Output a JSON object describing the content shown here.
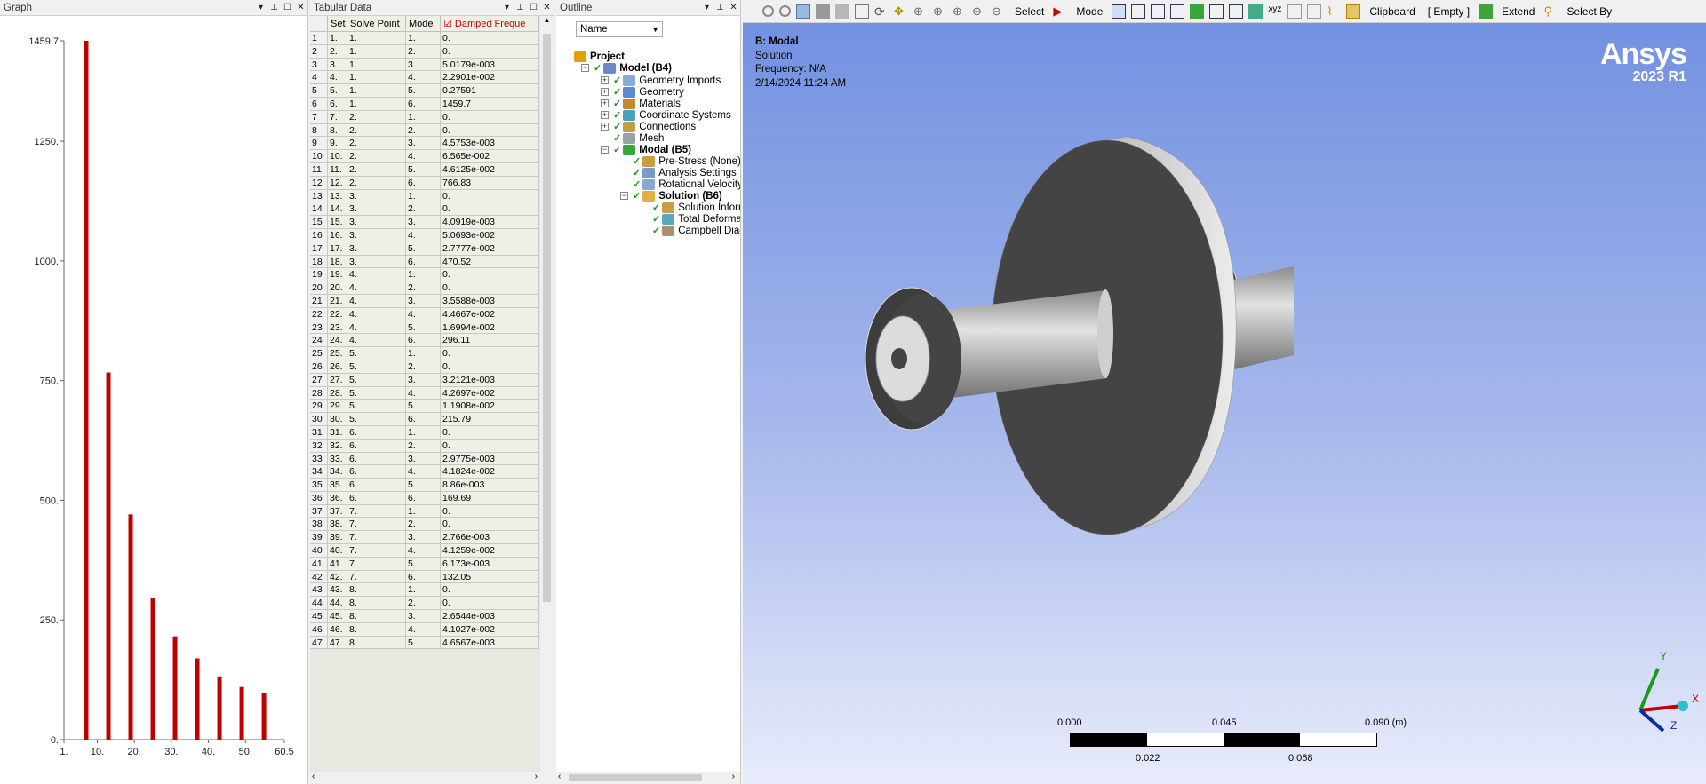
{
  "graph": {
    "title": "Graph",
    "chart_data": {
      "type": "bar",
      "x": [
        7,
        13,
        19,
        25,
        31,
        37,
        43,
        49,
        55
      ],
      "values": [
        1459.7,
        766.83,
        470.52,
        296.11,
        215.79,
        169.69,
        132.05,
        110,
        98
      ],
      "xticks": [
        "1.",
        "10.",
        "20.",
        "30.",
        "40.",
        "50.",
        "60.5"
      ],
      "yticks": [
        "0.",
        "250.",
        "500.",
        "750.",
        "1000.",
        "1250.",
        "1459.7"
      ],
      "xlim": [
        1,
        60.5
      ],
      "ylim": [
        0,
        1459.7
      ],
      "bar_color": "#c00000"
    }
  },
  "tabular": {
    "title": "Tabular Data",
    "headers": [
      "",
      "Set",
      "Solve Point",
      "Mode",
      "Damped Freque"
    ],
    "rows": [
      [
        "1",
        "1.",
        "1.",
        "1.",
        "0."
      ],
      [
        "2",
        "2.",
        "1.",
        "2.",
        "0."
      ],
      [
        "3",
        "3.",
        "1.",
        "3.",
        "5.0179e-003"
      ],
      [
        "4",
        "4.",
        "1.",
        "4.",
        "2.2901e-002"
      ],
      [
        "5",
        "5.",
        "1.",
        "5.",
        "0.27591"
      ],
      [
        "6",
        "6.",
        "1.",
        "6.",
        "1459.7"
      ],
      [
        "7",
        "7.",
        "2.",
        "1.",
        "0."
      ],
      [
        "8",
        "8.",
        "2.",
        "2.",
        "0."
      ],
      [
        "9",
        "9.",
        "2.",
        "3.",
        "4.5753e-003"
      ],
      [
        "10",
        "10.",
        "2.",
        "4.",
        "6.565e-002"
      ],
      [
        "11",
        "11.",
        "2.",
        "5.",
        "4.6125e-002"
      ],
      [
        "12",
        "12.",
        "2.",
        "6.",
        "766.83"
      ],
      [
        "13",
        "13.",
        "3.",
        "1.",
        "0."
      ],
      [
        "14",
        "14.",
        "3.",
        "2.",
        "0."
      ],
      [
        "15",
        "15.",
        "3.",
        "3.",
        "4.0919e-003"
      ],
      [
        "16",
        "16.",
        "3.",
        "4.",
        "5.0693e-002"
      ],
      [
        "17",
        "17.",
        "3.",
        "5.",
        "2.7777e-002"
      ],
      [
        "18",
        "18.",
        "3.",
        "6.",
        "470.52"
      ],
      [
        "19",
        "19.",
        "4.",
        "1.",
        "0."
      ],
      [
        "20",
        "20.",
        "4.",
        "2.",
        "0."
      ],
      [
        "21",
        "21.",
        "4.",
        "3.",
        "3.5588e-003"
      ],
      [
        "22",
        "22.",
        "4.",
        "4.",
        "4.4667e-002"
      ],
      [
        "23",
        "23.",
        "4.",
        "5.",
        "1.6994e-002"
      ],
      [
        "24",
        "24.",
        "4.",
        "6.",
        "296.11"
      ],
      [
        "25",
        "25.",
        "5.",
        "1.",
        "0."
      ],
      [
        "26",
        "26.",
        "5.",
        "2.",
        "0."
      ],
      [
        "27",
        "27.",
        "5.",
        "3.",
        "3.2121e-003"
      ],
      [
        "28",
        "28.",
        "5.",
        "4.",
        "4.2697e-002"
      ],
      [
        "29",
        "29.",
        "5.",
        "5.",
        "1.1908e-002"
      ],
      [
        "30",
        "30.",
        "5.",
        "6.",
        "215.79"
      ],
      [
        "31",
        "31.",
        "6.",
        "1.",
        "0."
      ],
      [
        "32",
        "32.",
        "6.",
        "2.",
        "0."
      ],
      [
        "33",
        "33.",
        "6.",
        "3.",
        "2.9775e-003"
      ],
      [
        "34",
        "34.",
        "6.",
        "4.",
        "4.1824e-002"
      ],
      [
        "35",
        "35.",
        "6.",
        "5.",
        "8.86e-003"
      ],
      [
        "36",
        "36.",
        "6.",
        "6.",
        "169.69"
      ],
      [
        "37",
        "37.",
        "7.",
        "1.",
        "0."
      ],
      [
        "38",
        "38.",
        "7.",
        "2.",
        "0."
      ],
      [
        "39",
        "39.",
        "7.",
        "3.",
        "2.766e-003"
      ],
      [
        "40",
        "40.",
        "7.",
        "4.",
        "4.1259e-002"
      ],
      [
        "41",
        "41.",
        "7.",
        "5.",
        "6.173e-003"
      ],
      [
        "42",
        "42.",
        "7.",
        "6.",
        "132.05"
      ],
      [
        "43",
        "43.",
        "8.",
        "1.",
        "0."
      ],
      [
        "44",
        "44.",
        "8.",
        "2.",
        "0."
      ],
      [
        "45",
        "45.",
        "8.",
        "3.",
        "2.6544e-003"
      ],
      [
        "46",
        "46.",
        "8.",
        "4.",
        "4.1027e-002"
      ],
      [
        "47",
        "47.",
        "8.",
        "5.",
        "4.6567e-003"
      ]
    ]
  },
  "outline": {
    "title": "Outline",
    "filter": "Name",
    "tree": [
      {
        "label": "Project",
        "bold": true,
        "icon": "project-icon"
      },
      {
        "label": "Model (B4)",
        "bold": true,
        "icon": "model-icon"
      },
      {
        "label": "Geometry Imports",
        "icon": "geometry-imports-icon"
      },
      {
        "label": "Geometry",
        "icon": "geometry-icon"
      },
      {
        "label": "Materials",
        "icon": "materials-icon"
      },
      {
        "label": "Coordinate Systems",
        "icon": "coordinate-systems-icon"
      },
      {
        "label": "Connections",
        "icon": "connections-icon"
      },
      {
        "label": "Mesh",
        "icon": "mesh-icon"
      },
      {
        "label": "Modal (B5)",
        "bold": true,
        "icon": "modal-icon"
      },
      {
        "label": "Pre-Stress (None)",
        "icon": "prestress-icon"
      },
      {
        "label": "Analysis Settings",
        "icon": "analysis-settings-icon"
      },
      {
        "label": "Rotational Velocity",
        "icon": "rotational-velocity-icon"
      },
      {
        "label": "Solution (B6)",
        "bold": true,
        "icon": "solution-icon"
      },
      {
        "label": "Solution Inforr",
        "icon": "solution-information-icon"
      },
      {
        "label": "Total Deforma",
        "icon": "total-deformation-icon"
      },
      {
        "label": "Campbell Diagı",
        "icon": "campbell-diagram-icon"
      }
    ]
  },
  "toolbar": {
    "select": "Select",
    "mode": "Mode",
    "clipboard": "Clipboard",
    "empty": "[ Empty ]",
    "extend": "Extend",
    "select_by": "Select By"
  },
  "viewport": {
    "info_title": "B: Modal",
    "info_sub": "Solution",
    "info_freq": "Frequency: N/A",
    "info_date": "2/14/2024 11:24 AM",
    "logo_name": "Ansys",
    "logo_version": "2023 R1",
    "scale_top": [
      "0.000",
      "0.045",
      "0.090 (m)"
    ],
    "scale_bottom": [
      "0.022",
      "0.068"
    ],
    "axis_labels": [
      "X",
      "Y",
      "Z"
    ]
  }
}
